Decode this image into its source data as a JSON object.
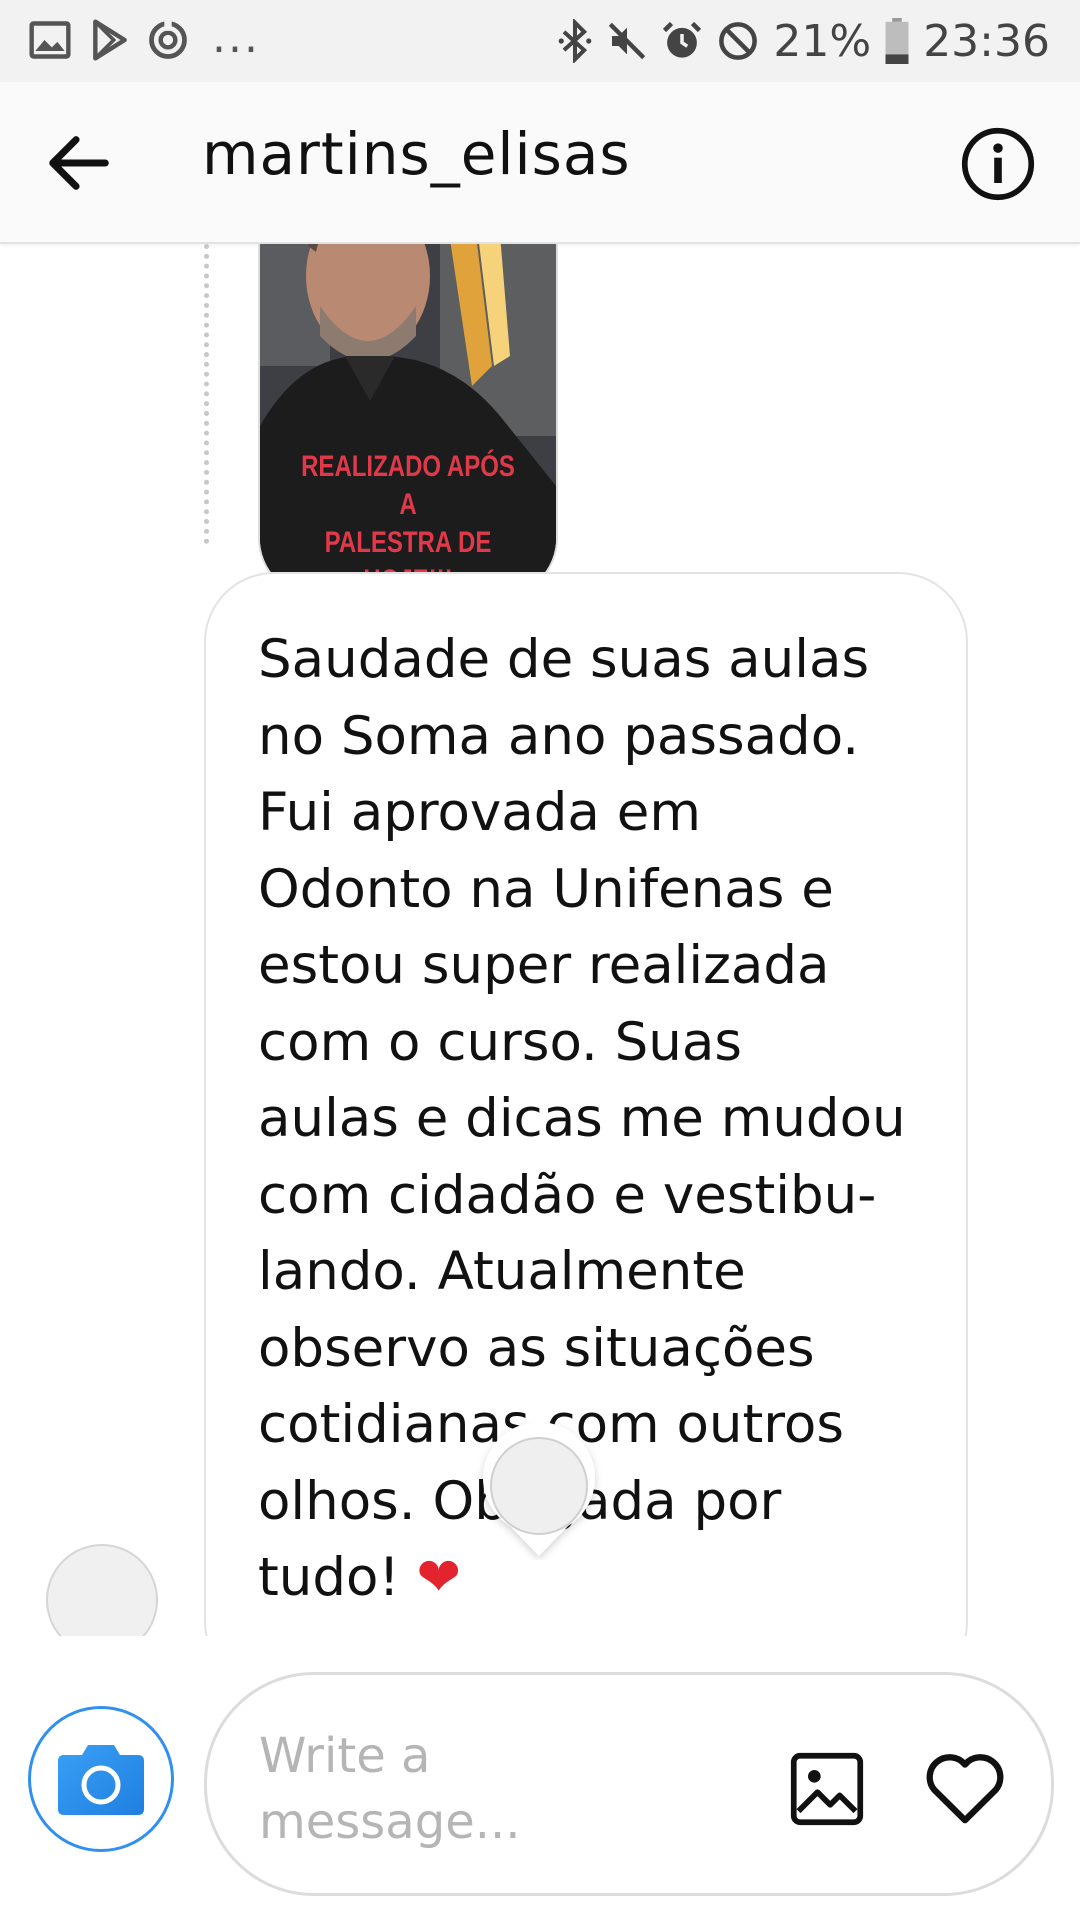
{
  "status_bar": {
    "battery": "21%",
    "time": "23:36",
    "overflow": "...",
    "icons": [
      "image-icon",
      "play-store-icon",
      "sync-icon",
      "bluetooth-icon",
      "mute-icon",
      "alarm-icon",
      "do-not-disturb-icon",
      "battery-icon"
    ]
  },
  "header": {
    "title": "martins_elisas",
    "back_icon": "back-arrow-icon",
    "info_icon": "info-icon"
  },
  "story": {
    "caption": "REALIZADO APÓS A\nPALESTRA DE HOJE!!!"
  },
  "message": {
    "text": "Saudade de suas aulas\nno Soma ano passado.\nFui aprovada em\nOdonto na Unifenas e\nestou super realizada\ncom o curso. Suas\naulas e dicas me mudou\ncom cidadão e vestibu-\nlando. Atualmente\nobservo as situações\ncotidianas com outros\nolhos. Obrigada por\ntudo!",
    "emoji": "❤"
  },
  "composer": {
    "placeholder": "Write a message...",
    "camera_icon": "camera-icon",
    "gallery_icon": "gallery-icon",
    "like_icon": "heart-icon"
  },
  "colors": {
    "accent": "#2f90f0",
    "caption_red": "#e0394a"
  }
}
